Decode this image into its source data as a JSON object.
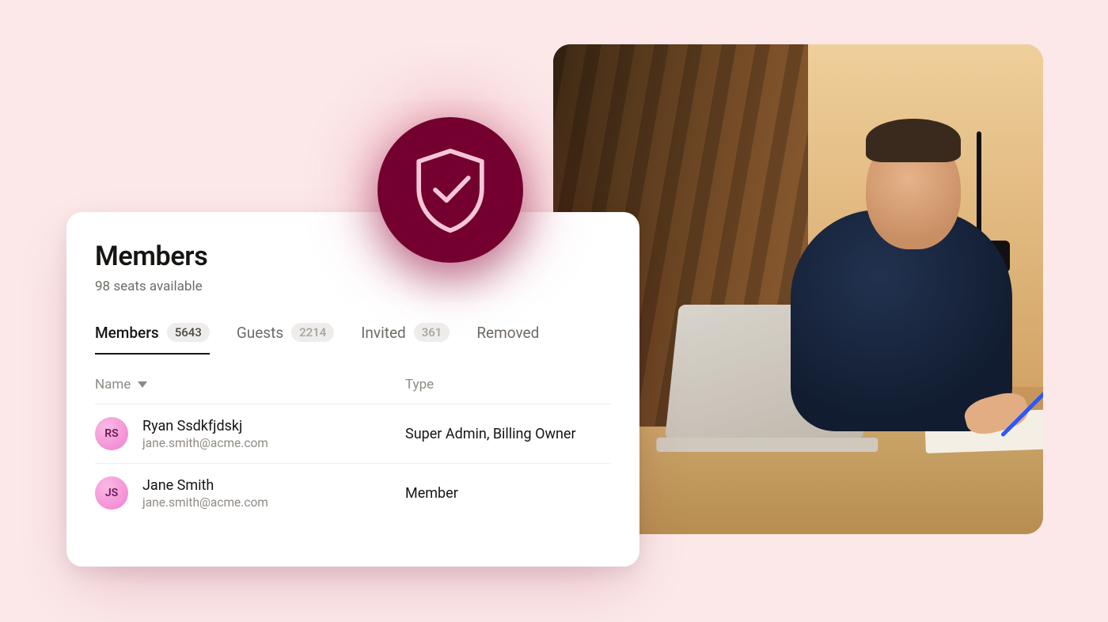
{
  "section": {
    "title": "Members",
    "subtitle": "98 seats available"
  },
  "tabs": [
    {
      "label": "Members",
      "count": "5643",
      "active": true
    },
    {
      "label": "Guests",
      "count": "2214",
      "active": false
    },
    {
      "label": "Invited",
      "count": "361",
      "active": false
    },
    {
      "label": "Removed",
      "count": null,
      "active": false
    }
  ],
  "columns": {
    "name": "Name",
    "type": "Type"
  },
  "rows": [
    {
      "initials": "RS",
      "name": "Ryan Ssdkfjdskj",
      "email": "jane.smith@acme.com",
      "type": "Super Admin, Billing Owner"
    },
    {
      "initials": "JS",
      "name": "Jane Smith",
      "email": "jane.smith@acme.com",
      "type": "Member"
    }
  ],
  "badge_icon": "shield-check-icon",
  "photo_alt": "Person working at a laptop"
}
